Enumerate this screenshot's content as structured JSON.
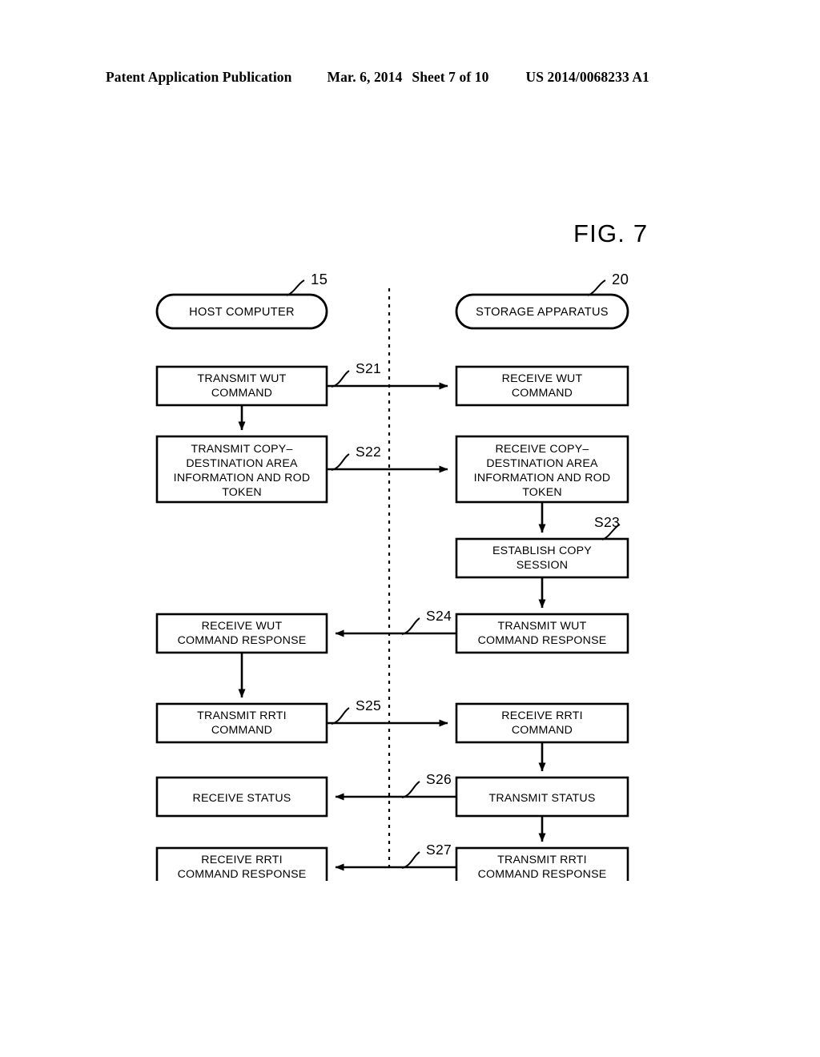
{
  "header": {
    "publication": "Patent Application Publication",
    "date": "Mar. 6, 2014",
    "sheet": "Sheet 7 of 10",
    "number": "US 2014/0068233 A1"
  },
  "figure": {
    "label": "FIG. 7"
  },
  "lanes": [
    {
      "id": "host",
      "title": "HOST COMPUTER",
      "ref": "15"
    },
    {
      "id": "storage",
      "title": "STORAGE APPARATUS",
      "ref": "20"
    }
  ],
  "boxes": {
    "b_transmit_wut_cmd": {
      "lines": [
        "TRANSMIT WUT",
        "COMMAND"
      ]
    },
    "b_receive_wut_cmd": {
      "lines": [
        "RECEIVE WUT",
        "COMMAND"
      ]
    },
    "b_transmit_copy_info": {
      "lines": [
        "TRANSMIT COPY–",
        "DESTINATION AREA",
        "INFORMATION AND ROD",
        "TOKEN"
      ]
    },
    "b_receive_copy_info": {
      "lines": [
        "RECEIVE COPY–",
        "DESTINATION AREA",
        "INFORMATION AND ROD",
        "TOKEN"
      ]
    },
    "b_establish_copy_session": {
      "lines": [
        "ESTABLISH COPY",
        "SESSION"
      ]
    },
    "b_receive_wut_resp": {
      "lines": [
        "RECEIVE WUT",
        "COMMAND RESPONSE"
      ]
    },
    "b_transmit_wut_resp": {
      "lines": [
        "TRANSMIT WUT",
        "COMMAND RESPONSE"
      ]
    },
    "b_transmit_rrti_cmd": {
      "lines": [
        "TRANSMIT RRTI",
        "COMMAND"
      ]
    },
    "b_receive_rrti_cmd": {
      "lines": [
        "RECEIVE RRTI",
        "COMMAND"
      ]
    },
    "b_receive_status": {
      "lines": [
        "RECEIVE STATUS"
      ]
    },
    "b_transmit_status": {
      "lines": [
        "TRANSMIT STATUS"
      ]
    },
    "b_receive_rrti_resp": {
      "lines": [
        "RECEIVE RRTI",
        "COMMAND RESPONSE"
      ]
    },
    "b_transmit_rrti_resp": {
      "lines": [
        "TRANSMIT RRTI",
        "COMMAND RESPONSE"
      ]
    }
  },
  "steps": [
    {
      "id": "s21",
      "label": "S21",
      "direction": "right"
    },
    {
      "id": "s22",
      "label": "S22",
      "direction": "right"
    },
    {
      "id": "s23",
      "label": "S23",
      "direction": "internal"
    },
    {
      "id": "s24",
      "label": "S24",
      "direction": "left"
    },
    {
      "id": "s25",
      "label": "S25",
      "direction": "right"
    },
    {
      "id": "s26",
      "label": "S26",
      "direction": "left"
    },
    {
      "id": "s27",
      "label": "S27",
      "direction": "left"
    }
  ]
}
